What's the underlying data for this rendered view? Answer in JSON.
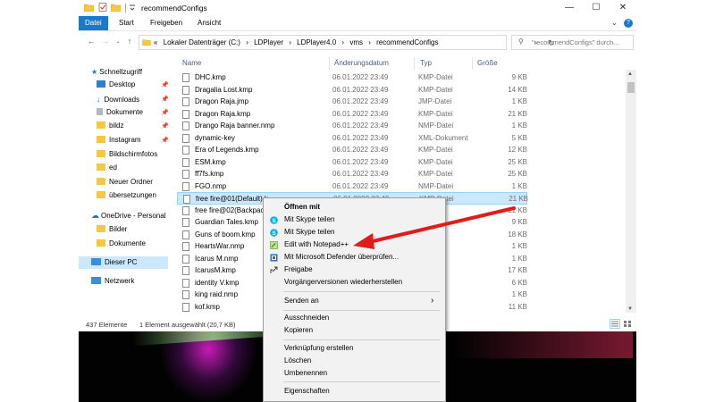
{
  "window": {
    "title": "recommendConfigs",
    "controls": {
      "minimize": "—",
      "maximize": "☐",
      "close": "✕"
    }
  },
  "ribbon": {
    "tabs": [
      "Datei",
      "Start",
      "Freigeben",
      "Ansicht"
    ],
    "chevron": "⌄",
    "help": "?"
  },
  "address": {
    "prefix": "«",
    "crumbs": [
      "Lokaler Datenträger (C:)",
      "LDPlayer",
      "LDPlayer4.0",
      "vms",
      "recommendConfigs"
    ],
    "separator": "›",
    "refresh": "↻"
  },
  "search": {
    "placeholder": "\"recommendConfigs\" durch..."
  },
  "nav": {
    "items": [
      {
        "label": "Schnellzugriff",
        "icon": "star-icon"
      },
      {
        "label": "Desktop",
        "icon": "desktop-icon",
        "pinned": true
      },
      {
        "label": "Downloads",
        "icon": "download-icon",
        "pinned": true
      },
      {
        "label": "Dokumente",
        "icon": "document-icon",
        "pinned": true
      },
      {
        "label": "bildz",
        "icon": "folder-icon",
        "pinned": true
      },
      {
        "label": "Instagram",
        "icon": "folder-icon",
        "pinned": true
      },
      {
        "label": "Bildschirmfotos",
        "icon": "folder-icon"
      },
      {
        "label": "ed",
        "icon": "folder-icon"
      },
      {
        "label": "Neuer Ordner",
        "icon": "folder-icon"
      },
      {
        "label": "übersetzungen",
        "icon": "folder-icon"
      },
      {
        "label": "OneDrive - Personal",
        "icon": "cloud-icon"
      },
      {
        "label": "Bilder",
        "icon": "folder-icon"
      },
      {
        "label": "Dokumente",
        "icon": "folder-icon"
      },
      {
        "label": "Dieser PC",
        "icon": "computer-icon"
      },
      {
        "label": "Netzwerk",
        "icon": "network-icon"
      }
    ]
  },
  "columns": {
    "name": "Name",
    "date": "Änderungsdatum",
    "type": "Typ",
    "size": "Größe"
  },
  "files": [
    {
      "name": "DHC.kmp",
      "date": "06.01.2022 23:49",
      "type": "KMP-Datei",
      "size": "9 KB"
    },
    {
      "name": "Dragalia Lost.kmp",
      "date": "06.01.2022 23:49",
      "type": "KMP-Datei",
      "size": "14 KB"
    },
    {
      "name": "Dragon Raja.jmp",
      "date": "06.01.2022 23:49",
      "type": "JMP-Datei",
      "size": "1 KB"
    },
    {
      "name": "Dragon Raja.kmp",
      "date": "06.01.2022 23:49",
      "type": "KMP-Datei",
      "size": "21 KB"
    },
    {
      "name": "Drango Raja banner.nmp",
      "date": "06.01.2022 23:49",
      "type": "NMP-Datei",
      "size": "1 KB"
    },
    {
      "name": "dynamic-key",
      "date": "06.01.2022 23:49",
      "type": "XML-Dokument",
      "size": "5 KB"
    },
    {
      "name": "Era of Legends.kmp",
      "date": "06.01.2022 23:49",
      "type": "KMP-Datei",
      "size": "12 KB"
    },
    {
      "name": "ESM.kmp",
      "date": "06.01.2022 23:49",
      "type": "KMP-Datei",
      "size": "25 KB"
    },
    {
      "name": "ff7fs.kmp",
      "date": "06.01.2022 23:49",
      "type": "KMP-Datei",
      "size": "25 KB"
    },
    {
      "name": "FGO.nmp",
      "date": "06.01.2022 23:49",
      "type": "NMP-Datei",
      "size": "1 KB"
    },
    {
      "name": "free fire@01(Default).k",
      "date": "06.01.2022 23:49",
      "type": "KMP-Datei",
      "size": "21 KB"
    },
    {
      "name": "free fire@02(Backpack",
      "date": "",
      "type": "-Datei",
      "size": "21 KB"
    },
    {
      "name": "Guardian Tales.kmp",
      "date": "",
      "type": "-Datei",
      "size": "9 KB"
    },
    {
      "name": "Guns of boom.kmp",
      "date": "",
      "type": "-Datei",
      "size": "18 KB"
    },
    {
      "name": "HeartsWar.nmp",
      "date": "",
      "type": "-Datei",
      "size": "1 KB"
    },
    {
      "name": "Icarus M.nmp",
      "date": "",
      "type": "-Datei",
      "size": "1 KB"
    },
    {
      "name": "IcarusM.kmp",
      "date": "",
      "type": "-Datei",
      "size": "17 KB"
    },
    {
      "name": "identity V.kmp",
      "date": "",
      "type": "-Datei",
      "size": "6 KB"
    },
    {
      "name": "king raid.nmp",
      "date": "",
      "type": "-Datei",
      "size": "1 KB"
    },
    {
      "name": "kof.kmp",
      "date": "",
      "type": "-Datei",
      "size": "11 KB"
    }
  ],
  "status": {
    "count": "437 Elemente",
    "selection": "1 Element ausgewählt (20,7 KB)"
  },
  "context_menu": {
    "items": [
      {
        "label": "Öffnen mit",
        "bold": true,
        "icon": ""
      },
      {
        "label": "Mit Skype teilen",
        "icon": "skype-icon"
      },
      {
        "label": "Mit Skype teilen",
        "icon": "skype-icon"
      },
      {
        "label": "Edit with Notepad++",
        "icon": "notepad-plus-plus-icon"
      },
      {
        "label": "Mit Microsoft Defender überprüfen...",
        "icon": "defender-icon"
      },
      {
        "label": "Freigabe",
        "icon": "share-icon"
      },
      {
        "label": "Vorgängerversionen wiederherstellen",
        "icon": ""
      },
      {
        "label": "Senden an",
        "icon": "",
        "submenu": "›"
      },
      {
        "label": "Ausschneiden",
        "icon": ""
      },
      {
        "label": "Kopieren",
        "icon": ""
      },
      {
        "label": "Verknüpfung erstellen",
        "icon": ""
      },
      {
        "label": "Löschen",
        "icon": ""
      },
      {
        "label": "Umbenennen",
        "icon": ""
      },
      {
        "label": "Eigenschaften",
        "icon": ""
      }
    ]
  },
  "colors": {
    "accent": "#1979ca",
    "selection": "#cce8ff",
    "arrow": "#e21b1b",
    "folder": "#f5c842"
  }
}
